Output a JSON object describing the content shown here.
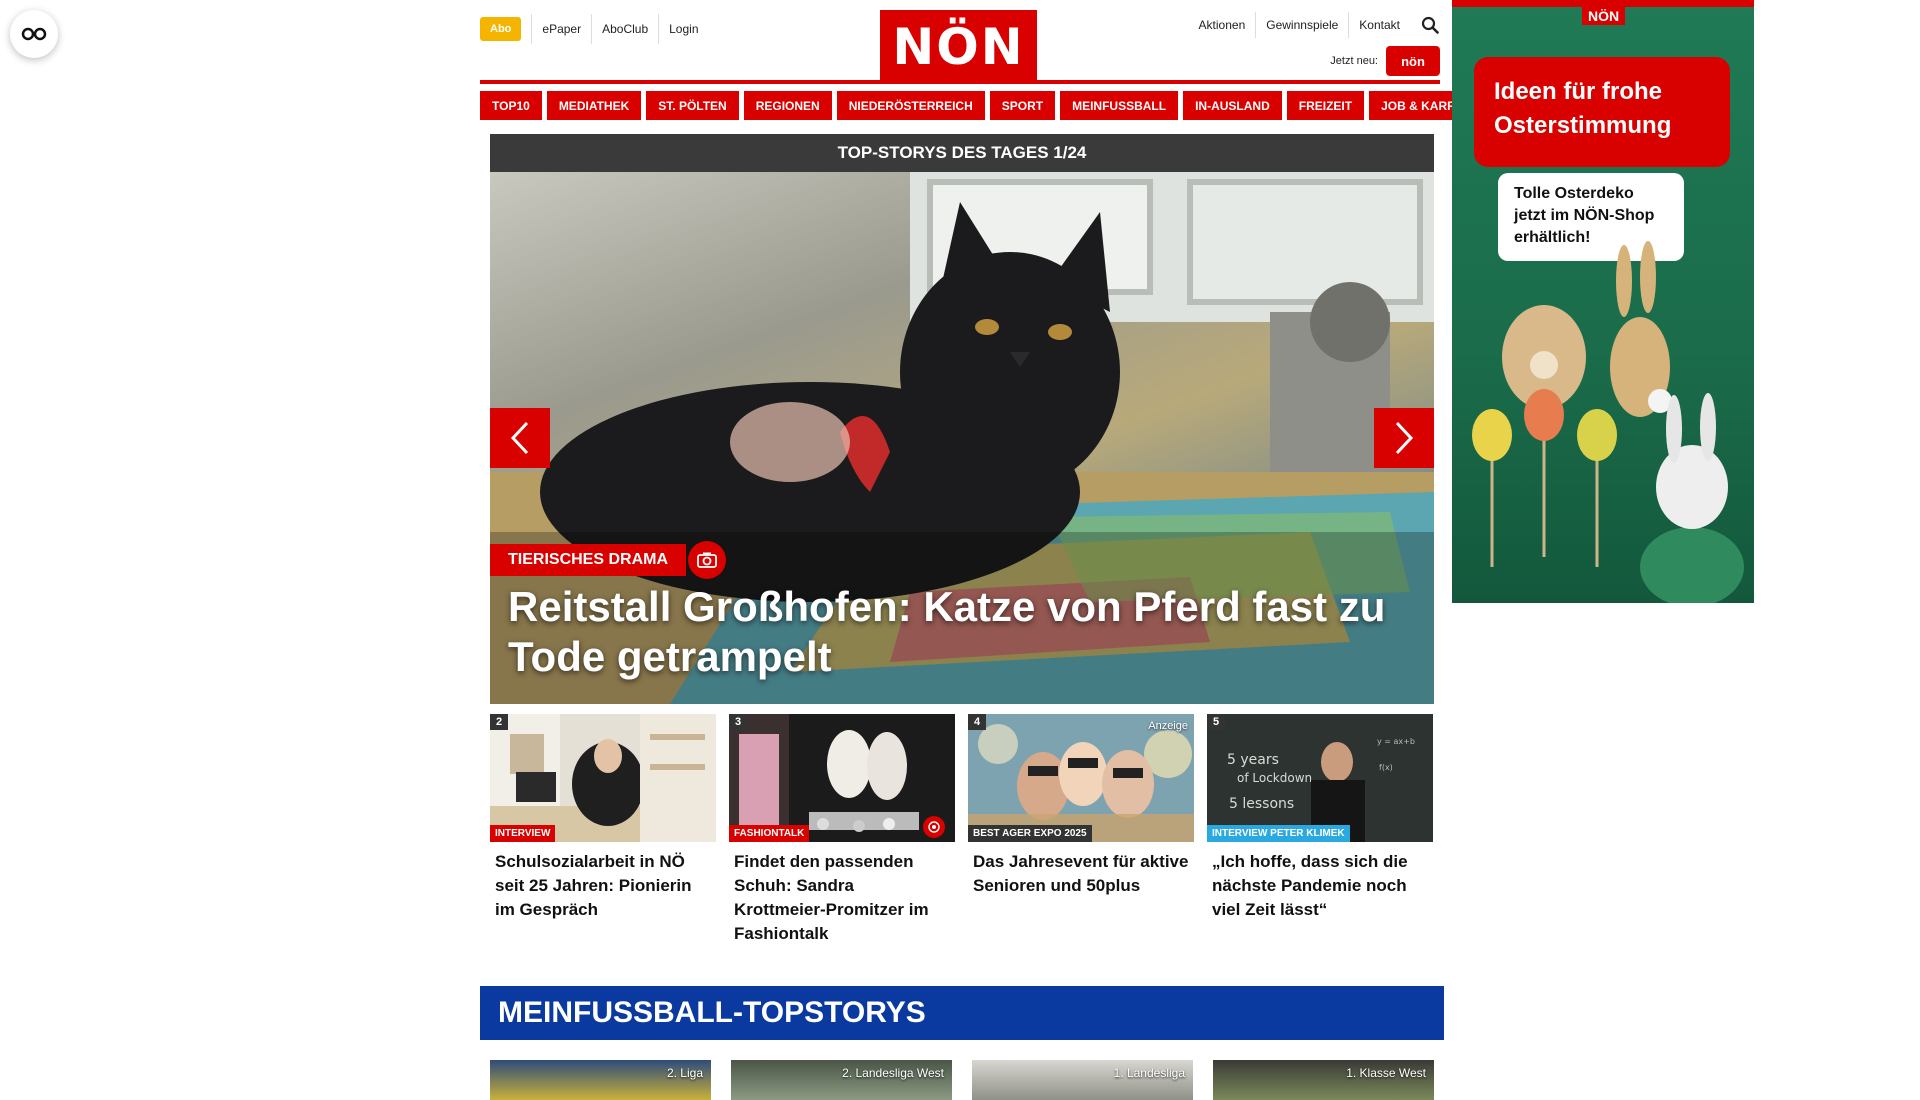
{
  "colors": {
    "brand_red": "#d90000",
    "abo_yellow": "#f5b400",
    "section_blue": "#0a3aa0"
  },
  "a11y": {
    "icon": "glasses-icon"
  },
  "header": {
    "abo": "Abo",
    "left_links": [
      "ePaper",
      "AboClub",
      "Login"
    ],
    "logo": "NÖN",
    "right_links": [
      "Aktionen",
      "Gewinnspiele",
      "Kontakt"
    ],
    "search_icon": "search-icon",
    "jetzt_neu": "Jetzt neu:",
    "app_badge": "nön"
  },
  "nav": [
    "TOP10",
    "MEDIATHEK",
    "ST. PÖLTEN",
    "REGIONEN",
    "NIEDERÖSTERREICH",
    "SPORT",
    "MEINFUSSBALL",
    "IN-AUSLAND",
    "FREIZEIT",
    "JOB & KARRIERE"
  ],
  "hero": {
    "heading": "TOP-STORYS DES TAGES 1/24",
    "tag": "TIERISCHES DRAMA",
    "title": "Reitstall Großhofen: Katze von Pferd fast zu Tode getrampelt"
  },
  "thumbs": [
    {
      "num": "2",
      "tag": "INTERVIEW",
      "title": "Schulsozialarbeit in NÖ seit 25 Jahren: Pionierin im Gespräch"
    },
    {
      "num": "3",
      "tag": "FASHIONTALK",
      "title": "Findet den passenden Schuh: Sandra Krottmeier-Promitzer im Fashiontalk"
    },
    {
      "num": "4",
      "tag": "BEST AGER EXPO 2025",
      "anzeige": "Anzeige",
      "title": "Das Jahresevent für aktive Senioren und 50plus"
    },
    {
      "num": "5",
      "tag": "INTERVIEW PETER KLIMEK",
      "title": "„Ich hoffe, dass sich die nächste Pandemie noch viel Zeit lässt“"
    }
  ],
  "section": {
    "title": "MEINFUSSBALL-TOPSTORYS",
    "thumbs": [
      "2. Liga",
      "2. Landesliga West",
      "1. Landesliga",
      "1. Klasse West"
    ]
  },
  "ad": {
    "logo": "NÖN",
    "headline": "Ideen für frohe Osterstimmung",
    "sub": "Tolle Osterdeko jetzt im NÖN-Shop erhältlich!"
  }
}
